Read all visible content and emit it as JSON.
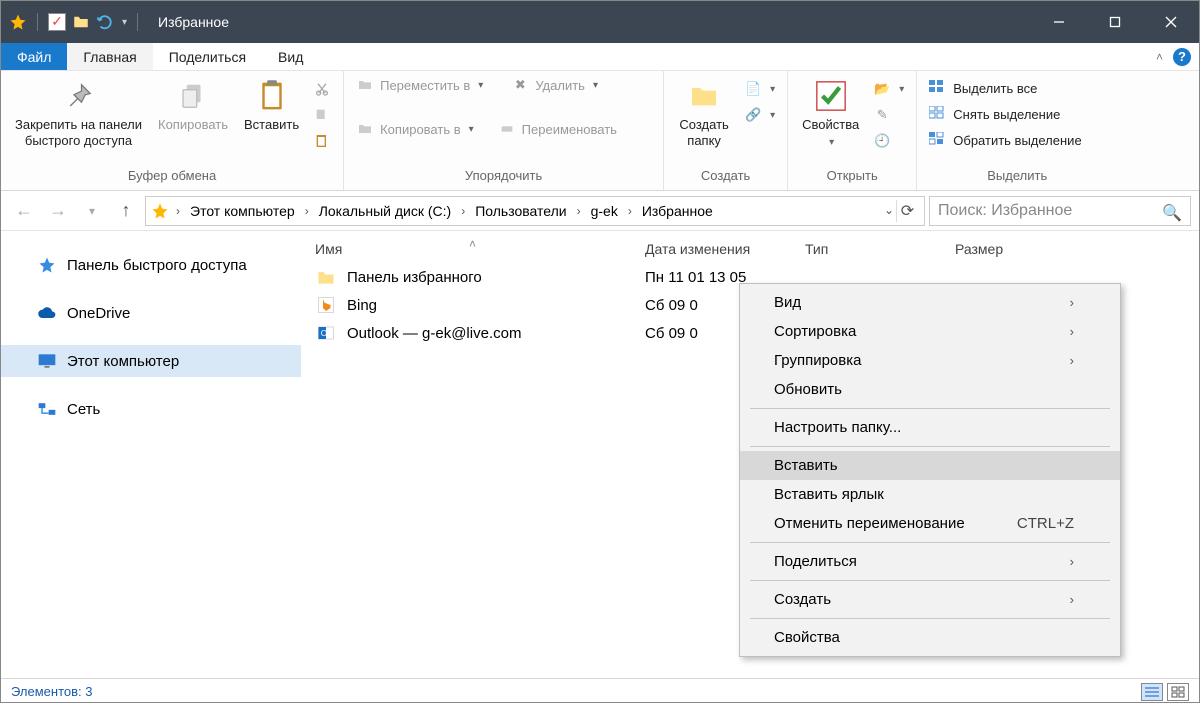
{
  "window": {
    "title": "Избранное"
  },
  "menu": {
    "file": "Файл",
    "home": "Главная",
    "share": "Поделиться",
    "view": "Вид"
  },
  "ribbon": {
    "clipboard": {
      "label": "Буфер обмена",
      "pin": "Закрепить на панели\nбыстрого доступа",
      "copy": "Копировать",
      "paste": "Вставить"
    },
    "organize": {
      "label": "Упорядочить",
      "move": "Переместить в",
      "copyto": "Копировать в",
      "delete": "Удалить",
      "rename": "Переименовать"
    },
    "new_": {
      "label": "Создать",
      "newfolder": "Создать\nпапку"
    },
    "open_": {
      "label": "Открыть",
      "properties": "Свойства"
    },
    "select_": {
      "label": "Выделить",
      "all": "Выделить все",
      "none": "Снять выделение",
      "invert": "Обратить выделение"
    }
  },
  "breadcrumbs": [
    "Этот компьютер",
    "Локальный диск (C:)",
    "Пользователи",
    "g-ek",
    "Избранное"
  ],
  "search": {
    "placeholder": "Поиск: Избранное"
  },
  "navpane": {
    "quick": "Панель быстрого доступа",
    "onedrive": "OneDrive",
    "thispc": "Этот компьютер",
    "network": "Сеть"
  },
  "columns": {
    "name": "Имя",
    "date": "Дата изменения",
    "type": "Тип",
    "size": "Размер"
  },
  "rows": [
    {
      "icon": "folder",
      "name": "Панель избранного",
      "date": "Пн 11 01 13 05"
    },
    {
      "icon": "bing",
      "name": "Bing",
      "date": "Сб 09 0"
    },
    {
      "icon": "outlook",
      "name": "Outlook — g-ek@live.com",
      "date": "Сб 09 0"
    }
  ],
  "context": {
    "view": "Вид",
    "sort": "Сортировка",
    "group": "Группировка",
    "refresh": "Обновить",
    "customize": "Настроить папку...",
    "paste": "Вставить",
    "paste_shortcut": "Вставить ярлык",
    "undo_rename": "Отменить переименование",
    "undo_key": "CTRL+Z",
    "share": "Поделиться",
    "newmenu": "Создать",
    "properties": "Свойства"
  },
  "status": {
    "items": "Элементов: 3"
  }
}
